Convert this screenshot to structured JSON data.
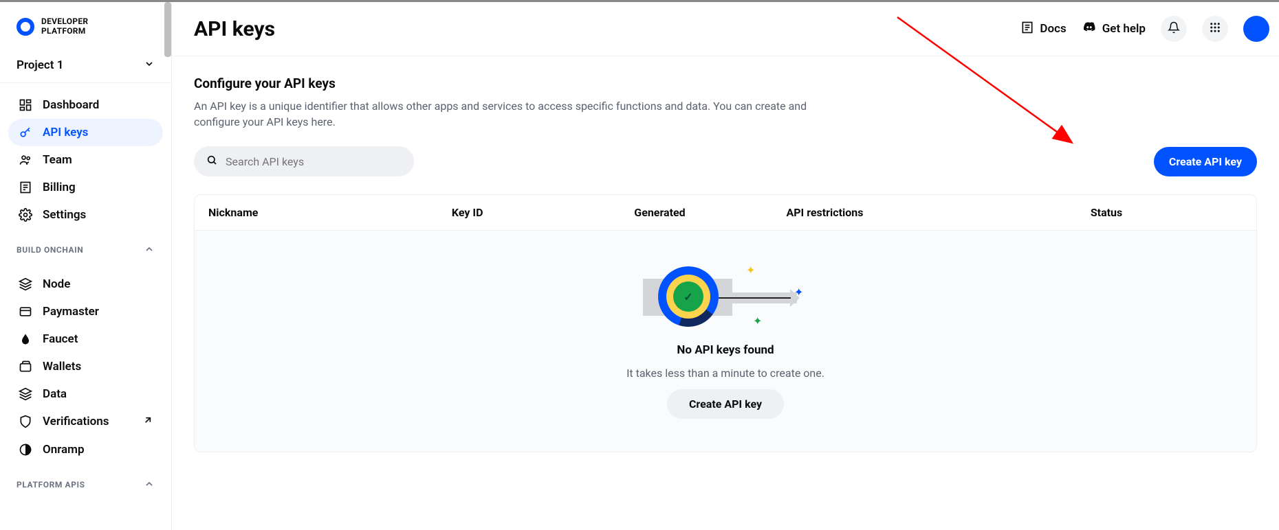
{
  "brand": {
    "line1": "DEVELOPER",
    "line2": "PLATFORM"
  },
  "project": {
    "name": "Project 1"
  },
  "nav": {
    "items": [
      {
        "label": "Dashboard"
      },
      {
        "label": "API keys"
      },
      {
        "label": "Team"
      },
      {
        "label": "Billing"
      },
      {
        "label": "Settings"
      }
    ]
  },
  "sections": {
    "build": {
      "title": "BUILD ONCHAIN",
      "items": [
        {
          "label": "Node"
        },
        {
          "label": "Paymaster"
        },
        {
          "label": "Faucet"
        },
        {
          "label": "Wallets"
        },
        {
          "label": "Data"
        },
        {
          "label": "Verifications"
        },
        {
          "label": "Onramp"
        }
      ]
    },
    "platform": {
      "title": "PLATFORM APIS"
    }
  },
  "topbar": {
    "title": "API keys",
    "docs": "Docs",
    "help": "Get help"
  },
  "page": {
    "subhead": "Configure your API keys",
    "desc": "An API key is a unique identifier that allows other apps and services to access specific functions and data. You can create and configure your API keys here.",
    "search_placeholder": "Search API keys",
    "create_label": "Create API key"
  },
  "table": {
    "headers": {
      "nickname": "Nickname",
      "keyid": "Key ID",
      "generated": "Generated",
      "restrictions": "API restrictions",
      "status": "Status"
    },
    "empty": {
      "title": "No API keys found",
      "sub": "It takes less than a minute to create one.",
      "cta": "Create API key"
    }
  },
  "colors": {
    "primary": "#0052ff"
  },
  "annotation": {
    "arrow_color": "#ff0000"
  }
}
